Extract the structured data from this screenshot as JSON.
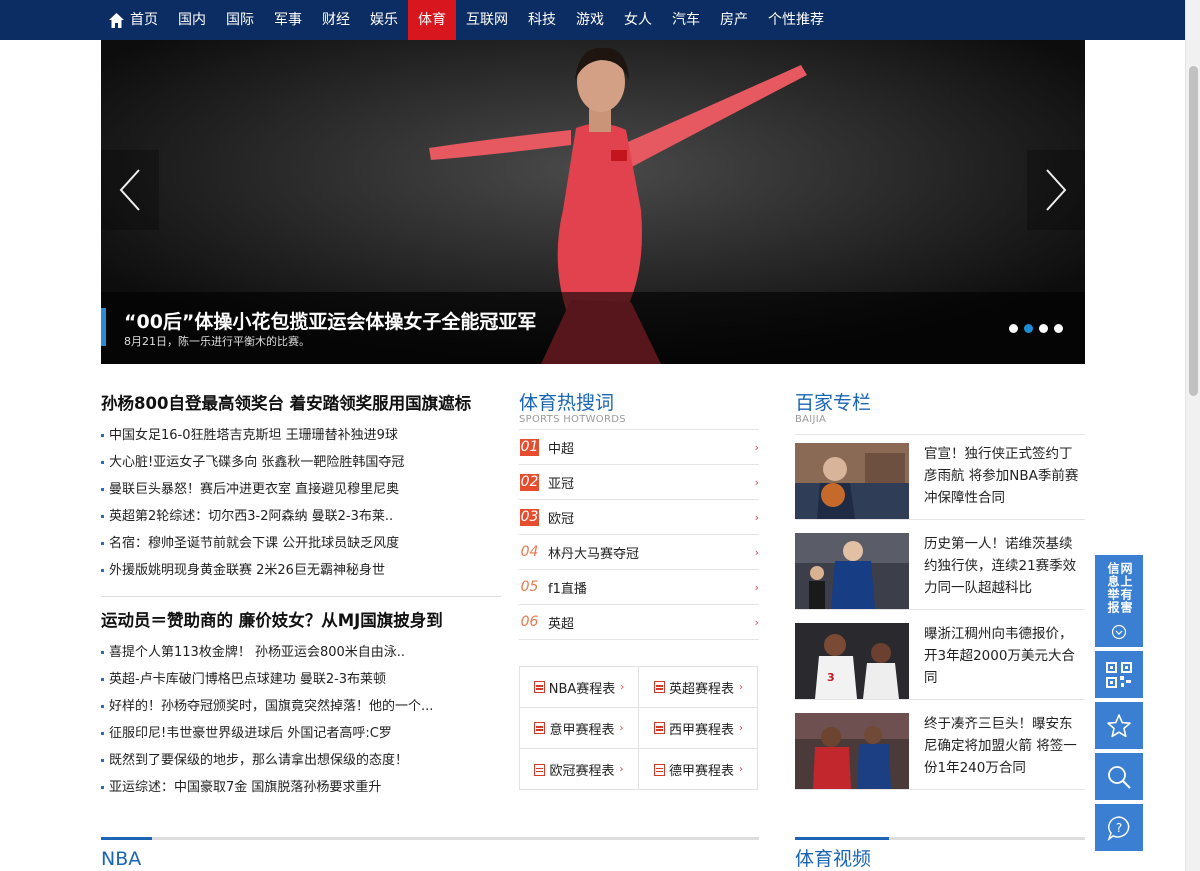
{
  "nav": {
    "items": [
      {
        "label": "首页",
        "icon": "home-icon"
      },
      {
        "label": "国内"
      },
      {
        "label": "国际"
      },
      {
        "label": "军事"
      },
      {
        "label": "财经"
      },
      {
        "label": "娱乐"
      },
      {
        "label": "体育",
        "active": true
      },
      {
        "label": "互联网"
      },
      {
        "label": "科技"
      },
      {
        "label": "游戏"
      },
      {
        "label": "女人"
      },
      {
        "label": "汽车"
      },
      {
        "label": "房产"
      },
      {
        "label": "个性推荐"
      }
    ]
  },
  "banner": {
    "title": "“00后”体操小花包揽亚运会体操女子全能冠亚军",
    "subtitle": "8月21日，陈一乐进行平衡木的比赛。",
    "active_dot": 1,
    "dot_count": 4,
    "accent": "#2a8ad4"
  },
  "news": {
    "headline1": "孙杨800自登最高领奖台 着安踏领奖服用国旗遮标",
    "list1": [
      "中国女足16-0狂胜塔吉克斯坦 王珊珊替补独进9球",
      "大心脏!亚运女子飞碟多向 张鑫秋一靶险胜韩国夺冠",
      "曼联巨头暴怒！赛后冲进更衣室 直接避见穆里尼奥",
      "英超第2轮综述：切尔西3-2阿森纳 曼联2-3布莱..",
      "名宿：穆帅圣诞节前就会下课 公开批球员缺乏风度",
      "外援版姚明现身黄金联赛 2米26巨无霸神秘身世"
    ],
    "headline2": "运动员＝赞助商的 廉价妓女？从MJ国旗披身到",
    "list2": [
      "喜提个人第113枚金牌！ 孙杨亚运会800米自由泳..",
      "英超-卢卡库破门博格巴点球建功 曼联2-3布莱顿",
      "好样的！孙杨夺冠颁奖时，国旗竟突然掉落！他的一个...",
      "征服印尼!韦世豪世界级进球后 外国记者高呼:C罗",
      "既然到了要保级的地步，那么请拿出想保级的态度！",
      "亚运综述：中国豪取7金 国旗脱落孙杨要求重升"
    ]
  },
  "hot": {
    "title": "体育热搜词",
    "subtitle": "SPORTS HOTWORDS",
    "items": [
      {
        "rank": "01",
        "name": "中超"
      },
      {
        "rank": "02",
        "name": "亚冠"
      },
      {
        "rank": "03",
        "name": "欧冠"
      },
      {
        "rank": "04",
        "name": "林丹大马赛夺冠"
      },
      {
        "rank": "05",
        "name": "f1直播"
      },
      {
        "rank": "06",
        "name": "英超"
      }
    ],
    "schedules": [
      "NBA赛程表",
      "英超赛程表",
      "意甲赛程表",
      "西甲赛程表",
      "欧冠赛程表",
      "德甲赛程表"
    ]
  },
  "baijia": {
    "title": "百家专栏",
    "subtitle": "BAIJIA",
    "items": [
      {
        "text": "官宣！独行侠正式签约丁彦雨航 将参加NBA季前赛冲保障性合同"
      },
      {
        "text": "历史第一人！诺维茨基续约独行侠，连续21赛季效力同一队超越科比"
      },
      {
        "text": "曝浙江稠州向韦德报价，开3年超2000万美元大合同"
      },
      {
        "text": "终于凑齐三巨头！曝安东尼确定将加盟火箭 将签一份1年240万合同"
      }
    ]
  },
  "bottom": {
    "nba_title": "NBA",
    "video_title": "体育视频"
  },
  "tools": {
    "report_label": "网上有害信息举报",
    "icons": [
      "qrcode-icon",
      "star-icon",
      "search-icon",
      "help-icon"
    ]
  },
  "colors": {
    "nav_bg": "#0c2d63",
    "nav_active": "#d7161d",
    "link_blue": "#1a66b5",
    "tool_blue": "#3a7fd2"
  }
}
